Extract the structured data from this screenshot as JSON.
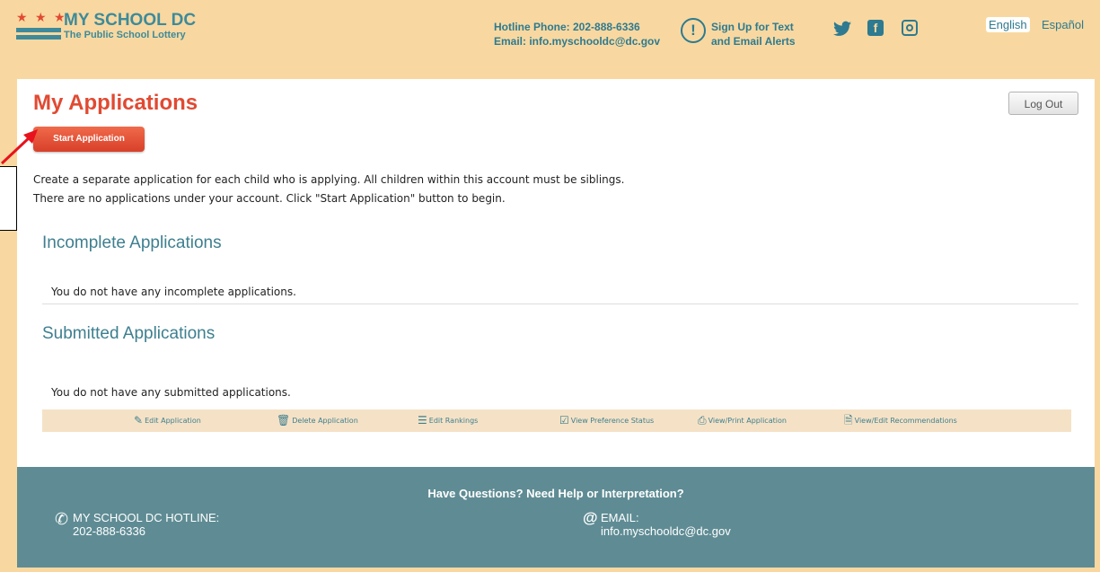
{
  "header": {
    "logo_stars": "★ ★ ★",
    "logo_title": "MY SCHOOL DC",
    "logo_subtitle": "The Public School Lottery",
    "hotline": "Hotline Phone: 202-888-6336",
    "email": "Email: info.myschooldc@dc.gov",
    "alerts_line1": "Sign Up for Text",
    "alerts_line2": "and Email Alerts",
    "lang_english": "English",
    "lang_spanish": "Español"
  },
  "main": {
    "title": "My Applications",
    "start_button": "Start Application",
    "logout_button": "Log Out",
    "intro_line1": "Create a separate application for each child who is applying. All children within this account must be siblings.",
    "intro_line2": "There are no applications under your account. Click \"Start Application\" button to begin.",
    "incomplete_heading": "Incomplete Applications",
    "incomplete_empty": "You do not have any incomplete applications.",
    "submitted_heading": "Submitted Applications",
    "submitted_empty": "You do not have any submitted applications.",
    "actions": [
      {
        "label": "Edit Application",
        "icon": "edit-icon"
      },
      {
        "label": "Delete Application",
        "icon": "trash-icon"
      },
      {
        "label": "Edit Rankings",
        "icon": "list-icon"
      },
      {
        "label": "View Preference Status",
        "icon": "checkbox-icon"
      },
      {
        "label": "View/Print Application",
        "icon": "printer-icon"
      },
      {
        "label": "View/Edit Recommendations",
        "icon": "document-icon"
      }
    ]
  },
  "footer": {
    "question": "Have Questions? Need Help or Interpretation?",
    "hotline_label": "MY SCHOOL DC HOTLINE:",
    "hotline_number": "202-888-6336",
    "email_label": "EMAIL:",
    "email_address": "info.myschooldc@dc.gov"
  },
  "colors": {
    "accent_red": "#e14a32",
    "teal": "#3e8a9a",
    "background": "#f8d8a0",
    "footer": "#5f8c94"
  }
}
